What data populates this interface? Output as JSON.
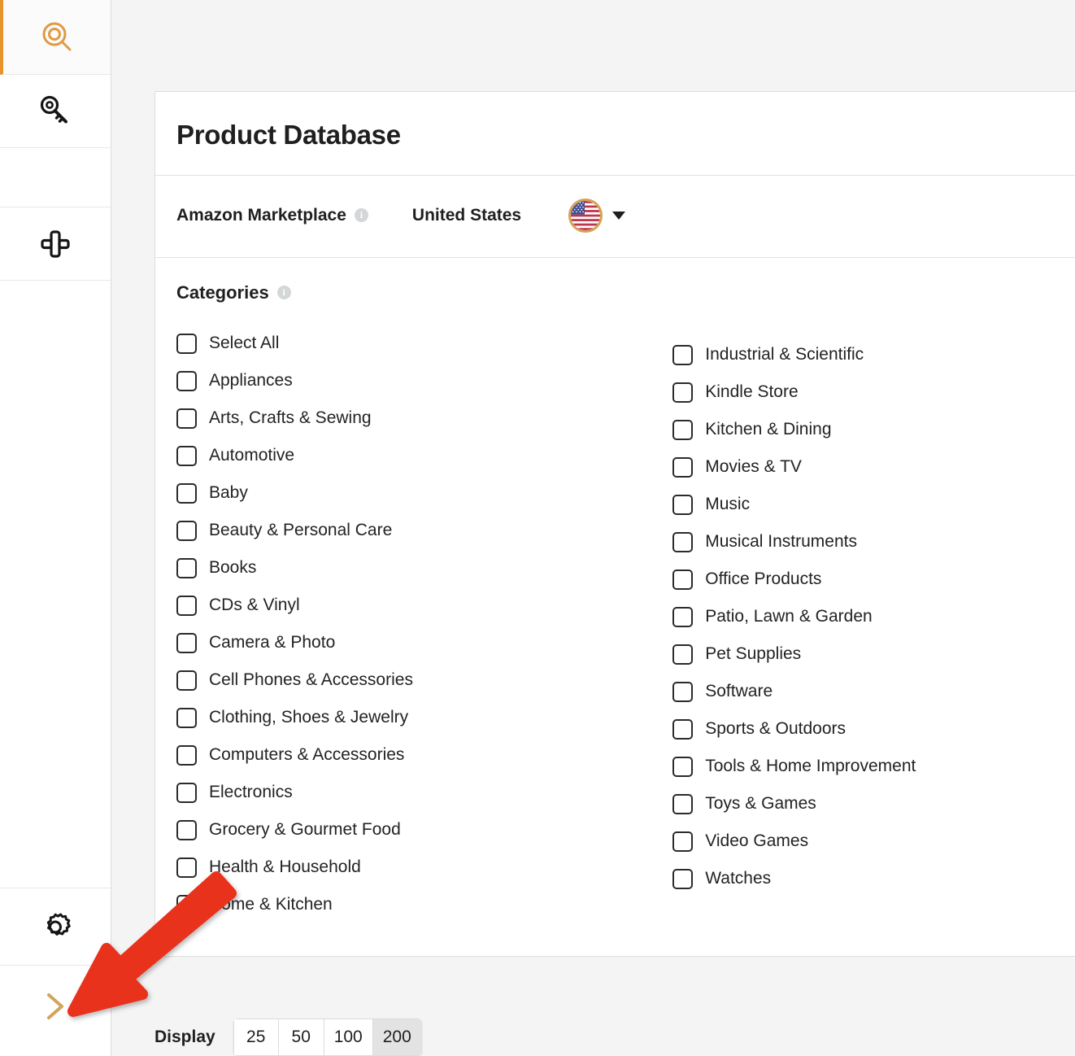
{
  "sidebar": {
    "items": [
      {
        "name": "product-database",
        "icon": "magnifier-circle-icon",
        "active": true
      },
      {
        "name": "keyword-tool",
        "icon": "key-icon",
        "active": false
      },
      {
        "name": "blank-slot",
        "icon": "none",
        "active": false
      },
      {
        "name": "extension-tool",
        "icon": "plug-icon",
        "active": false
      }
    ],
    "settings_icon": "gear-icon",
    "expand_icon": "chevron-right-icon"
  },
  "header": {
    "title": "Product Database"
  },
  "marketplace": {
    "label": "Amazon Marketplace",
    "info_icon": "info-icon",
    "info_glyph": "i",
    "country": "United States",
    "flag_icon": "us-flag-icon",
    "dropdown_icon": "caret-down-icon"
  },
  "categories": {
    "heading": "Categories",
    "info_icon": "info-icon",
    "info_glyph": "i",
    "left_column": [
      "Select All",
      "Appliances",
      "Arts, Crafts & Sewing",
      "Automotive",
      "Baby",
      "Beauty & Personal Care",
      "Books",
      "CDs & Vinyl",
      "Camera & Photo",
      "Cell Phones & Accessories",
      "Clothing, Shoes & Jewelry",
      "Computers & Accessories",
      "Electronics",
      "Grocery & Gourmet Food",
      "Health & Household",
      "Home & Kitchen"
    ],
    "right_column": [
      "Industrial & Scientific",
      "Kindle Store",
      "Kitchen & Dining",
      "Movies & TV",
      "Music",
      "Musical Instruments",
      "Office Products",
      "Patio, Lawn & Garden",
      "Pet Supplies",
      "Software",
      "Sports & Outdoors",
      "Tools & Home Improvement",
      "Toys & Games",
      "Video Games",
      "Watches"
    ]
  },
  "display": {
    "label": "Display",
    "options": [
      "25",
      "50",
      "100",
      "200"
    ],
    "selected": "200"
  },
  "annotation": {
    "arrow_color": "#e8331c",
    "arrow_name": "red-pointer-arrow"
  },
  "colors": {
    "accent": "#e8922e",
    "page_background": "#f4f4f4",
    "card_background": "#ffffff",
    "text": "#1f1f1f"
  }
}
